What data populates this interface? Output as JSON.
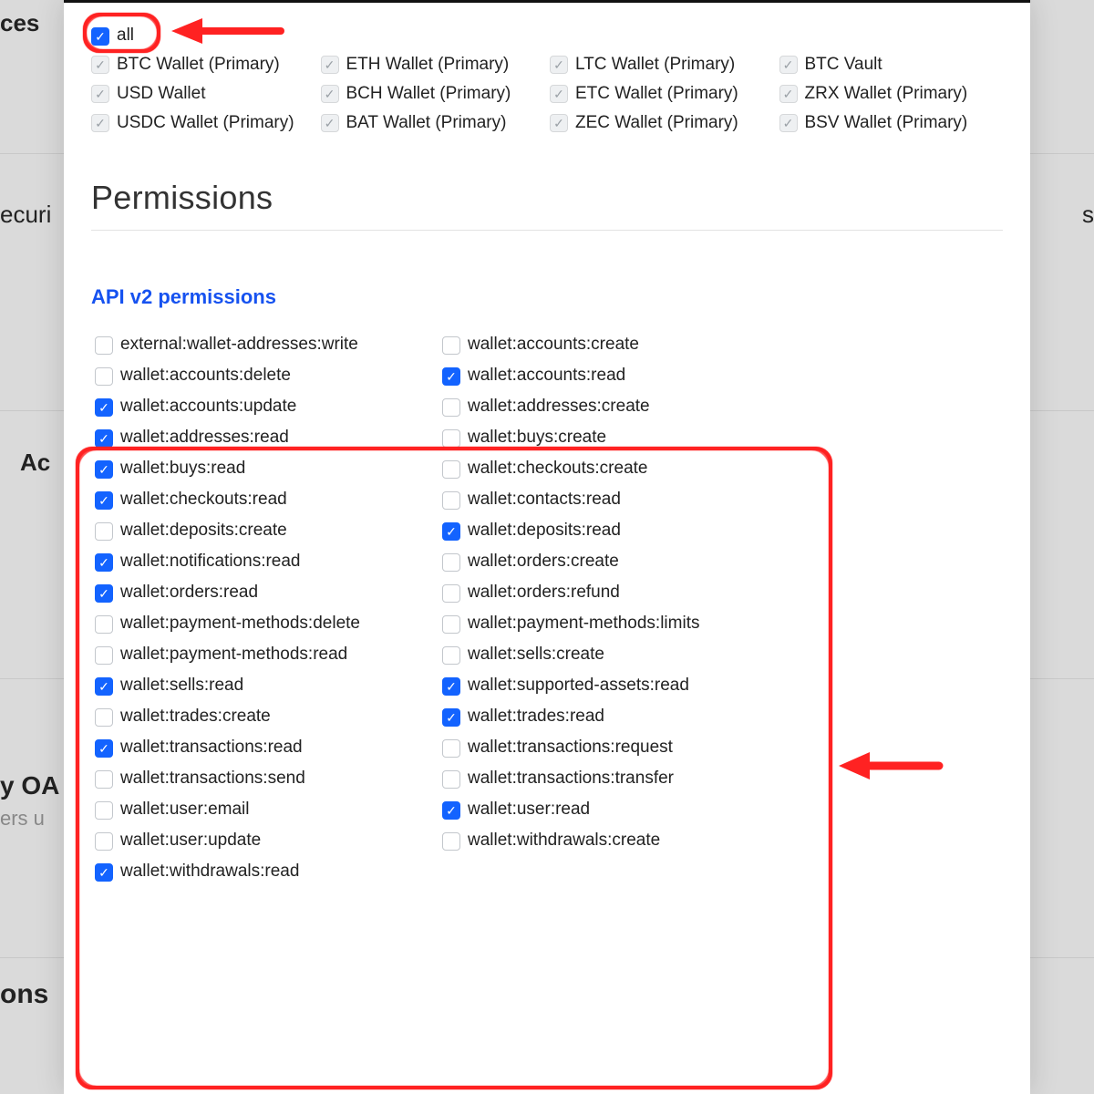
{
  "background": {
    "left1": "ces",
    "left2": "ecuri",
    "left3": "Ac",
    "left4": "y OA",
    "left5": "ers u",
    "left6": "ons",
    "right1": "s"
  },
  "walletsSection": {
    "all_label": "all",
    "wallets": [
      {
        "label": "BTC Wallet (Primary)",
        "id": "btc-wallet"
      },
      {
        "label": "ETH Wallet (Primary)",
        "id": "eth-wallet"
      },
      {
        "label": "LTC Wallet (Primary)",
        "id": "ltc-wallet"
      },
      {
        "label": "BTC Vault",
        "id": "btc-vault"
      },
      {
        "label": "USD Wallet",
        "id": "usd-wallet"
      },
      {
        "label": "BCH Wallet (Primary)",
        "id": "bch-wallet"
      },
      {
        "label": "ETC Wallet (Primary)",
        "id": "etc-wallet"
      },
      {
        "label": "ZRX Wallet (Primary)",
        "id": "zrx-wallet"
      },
      {
        "label": "USDC Wallet (Primary)",
        "id": "usdc-wallet"
      },
      {
        "label": "BAT Wallet (Primary)",
        "id": "bat-wallet"
      },
      {
        "label": "ZEC Wallet (Primary)",
        "id": "zec-wallet"
      },
      {
        "label": "BSV Wallet (Primary)",
        "id": "bsv-wallet"
      }
    ]
  },
  "headers": {
    "permissions": "Permissions",
    "api_v2": "API v2 permissions"
  },
  "permissions": [
    {
      "label": "external:wallet-addresses:write",
      "checked": false
    },
    {
      "label": "wallet:accounts:create",
      "checked": false
    },
    {
      "label": "wallet:accounts:delete",
      "checked": false
    },
    {
      "label": "wallet:accounts:read",
      "checked": true
    },
    {
      "label": "wallet:accounts:update",
      "checked": true
    },
    {
      "label": "wallet:addresses:create",
      "checked": false
    },
    {
      "label": "wallet:addresses:read",
      "checked": true
    },
    {
      "label": "wallet:buys:create",
      "checked": false
    },
    {
      "label": "wallet:buys:read",
      "checked": true
    },
    {
      "label": "wallet:checkouts:create",
      "checked": false
    },
    {
      "label": "wallet:checkouts:read",
      "checked": true
    },
    {
      "label": "wallet:contacts:read",
      "checked": false
    },
    {
      "label": "wallet:deposits:create",
      "checked": false
    },
    {
      "label": "wallet:deposits:read",
      "checked": true
    },
    {
      "label": "wallet:notifications:read",
      "checked": true
    },
    {
      "label": "wallet:orders:create",
      "checked": false
    },
    {
      "label": "wallet:orders:read",
      "checked": true
    },
    {
      "label": "wallet:orders:refund",
      "checked": false
    },
    {
      "label": "wallet:payment-methods:delete",
      "checked": false
    },
    {
      "label": "wallet:payment-methods:limits",
      "checked": false
    },
    {
      "label": "wallet:payment-methods:read",
      "checked": false
    },
    {
      "label": "wallet:sells:create",
      "checked": false
    },
    {
      "label": "wallet:sells:read",
      "checked": true
    },
    {
      "label": "wallet:supported-assets:read",
      "checked": true
    },
    {
      "label": "wallet:trades:create",
      "checked": false
    },
    {
      "label": "wallet:trades:read",
      "checked": true
    },
    {
      "label": "wallet:transactions:read",
      "checked": true
    },
    {
      "label": "wallet:transactions:request",
      "checked": false
    },
    {
      "label": "wallet:transactions:send",
      "checked": false
    },
    {
      "label": "wallet:transactions:transfer",
      "checked": false
    },
    {
      "label": "wallet:user:email",
      "checked": false
    },
    {
      "label": "wallet:user:read",
      "checked": true
    },
    {
      "label": "wallet:user:update",
      "checked": false
    },
    {
      "label": "wallet:withdrawals:create",
      "checked": false
    },
    {
      "label": "wallet:withdrawals:read",
      "checked": true
    }
  ]
}
